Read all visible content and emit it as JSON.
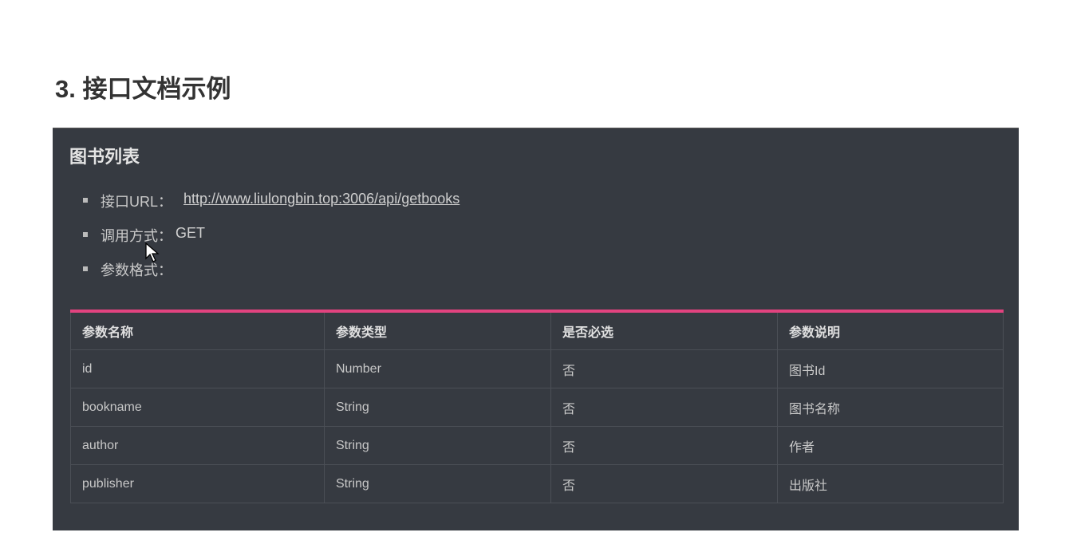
{
  "heading": "3. 接口文档示例",
  "panel": {
    "title": "图书列表",
    "items": [
      {
        "label": "接口URL：",
        "value": "http://www.liulongbin.top:3006/api/getbooks"
      },
      {
        "label": "调用方式：",
        "value": "GET"
      },
      {
        "label": "参数格式：",
        "value": ""
      }
    ],
    "table": {
      "headers": [
        "参数名称",
        "参数类型",
        "是否必选",
        "参数说明"
      ],
      "rows": [
        [
          "id",
          "Number",
          "否",
          "图书Id"
        ],
        [
          "bookname",
          "String",
          "否",
          "图书名称"
        ],
        [
          "author",
          "String",
          "否",
          "作者"
        ],
        [
          "publisher",
          "String",
          "否",
          "出版社"
        ]
      ]
    }
  }
}
